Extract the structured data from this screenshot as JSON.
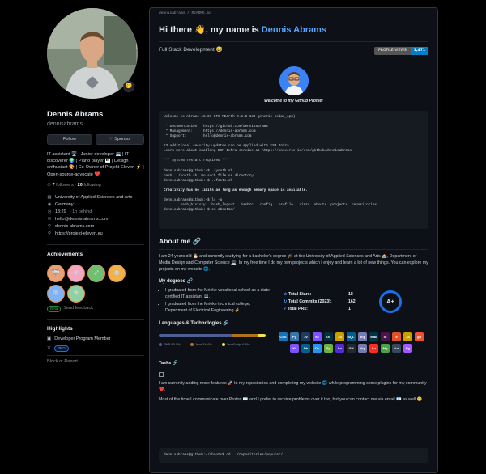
{
  "profile": {
    "name": "Dennis Abrams",
    "login": "dennisabrams",
    "follow_label": "Follow",
    "sponsor_label": "Sponsor",
    "bio": "IT assistant 🖥️ | Junior developer 💻 | IT discoverer 🌍 | Piano player 🎹 | Design enthusiast 🎨 | Co-Owner of Projekt-Eleven ⚡ | Open-source-advocate ❤️",
    "followers": "7",
    "followers_label": "followers",
    "following": "20",
    "following_label": "following",
    "details": [
      {
        "icon": "organization-icon",
        "glyph": "▦",
        "text": "University of Applied Sciences and Arts",
        "muted": ""
      },
      {
        "icon": "location-icon",
        "glyph": "◉",
        "text": "Germany",
        "muted": ""
      },
      {
        "icon": "clock-icon",
        "glyph": "◷",
        "text": "13:29",
        "muted": "- 1h behind"
      },
      {
        "icon": "mail-icon",
        "glyph": "✉",
        "text": "hello@dennis-abrams.com",
        "muted": ""
      },
      {
        "icon": "link-icon",
        "glyph": "⚲",
        "text": "dennis-abrams.com",
        "muted": ""
      },
      {
        "icon": "link-icon",
        "glyph": "⚲",
        "text": "https://projekt-eleven.eu",
        "muted": ""
      }
    ],
    "achievements_title": "Achievements",
    "beta_label": "Beta",
    "send_feedback": "Send feedback",
    "highlights_title": "Highlights",
    "highlight_item": "Developer Program Member",
    "pro_label": "PRO",
    "block_report": "Block or Report"
  },
  "readme": {
    "path": "dennisabrams / README.md",
    "greeting": "Hi there 👋, my name is ",
    "greeting_name": "Dennis Abrams",
    "subtitle": "Full Stack Development 😅",
    "views_label": "PROFILE VIEWS",
    "views_count": "1,471",
    "welcome": "Welcome to my Github Profile!",
    "terminal": [
      "Welcome to Abrams 16.01 LTS FEarth 0.6.0-149-generic solar_cpu)",
      "",
      " * Documentation:  https://github.com/dennisabrams",
      " * Management:     https://dennis-abrams.com",
      " * Support:        hello@dennis-abrams.com",
      "",
      "23 additional security updates can be applied with ESM Infra.",
      "Learn more about enabling ESM Infra service at https://universe.io/esm/github/dennisabrams",
      "",
      "*** System restart required ***",
      "",
      "dennisabrams@github:~$ ./youth.sh",
      "bash: ./youth.sh: No such file or directory",
      "dennisabrams@github:~$ ./facts.sh",
      "",
      "Creativity has no limits as long as enough memory space is available.",
      "",
      "dennisabrams@github:~$ ls -a",
      ".  ..  .bash_history  .bash_logout  .bashrc  .config  .profile  .vimrc  abouts  projects  repositories",
      "dennisabrams@github:~$ cd aboutme/"
    ],
    "about_title": "About me",
    "about_text": "I am 24 years old 🎂 and currently studying for a bachelor's degree 🎓 at the University of Applied Sciences and Arts 🏫, Department of Media Design and Computer Science 💻. In my free time I do my own projects which I enjoy and learn a lot of new things. You can explore my projects on my website 🌐.",
    "degrees_title": "My degrees",
    "degrees": [
      "I graduated from the Mrieke vocational school as a state-certified IT assistant 💻.",
      "I graduated from the Mrieke technical college, Department of Electrical Engineering ⚡."
    ],
    "stats": [
      {
        "label": "Total Stars:",
        "value": "18"
      },
      {
        "label": "Total Commits (2023):",
        "value": "162"
      },
      {
        "label": "Total PRs:",
        "value": "1"
      }
    ],
    "grade": "A+",
    "langs_title": "Languages & Technologies",
    "tasks_title": "Tasks",
    "tasks_text": "I am currently adding more features 🚀 to my repositories and completing my website 🌐 while programming some plugins for my community ❤️.",
    "contact_text": "Most of the time I communicate over Proton ✉️ and I prefer to receive problems over it too, but you can contact me via email 📧 as well 😊.",
    "bottom_cmd": "dennisabrams@github:~/abouts$ cd ../repositories/popular/"
  },
  "chart_data": {
    "type": "bar",
    "title": "",
    "categories": [
      "PHP",
      "Java",
      "JavaScript"
    ],
    "series": [
      {
        "values": [
          69,
          24.4,
          6.6
        ]
      }
    ],
    "legend": [
      "PHP 69.0%",
      "Java 24.4%",
      "JavaScript 6.6%"
    ],
    "colors": [
      "#4f5d95",
      "#b07219",
      "#f1e05a"
    ]
  },
  "tech_icons": [
    {
      "icon": "css3-icon",
      "txt": "CSS",
      "color": "#1572b6"
    },
    {
      "icon": "python-icon",
      "txt": "Py",
      "color": "#3776ab"
    },
    {
      "icon": "java-icon",
      "txt": "Jv",
      "color": "#1d3b5c"
    },
    {
      "icon": "kotlin-icon",
      "txt": "Kt",
      "color": "#7f52ff"
    },
    {
      "icon": "gradle-icon",
      "txt": "Gr",
      "color": "#02303a"
    },
    {
      "icon": "js-icon",
      "txt": "JS",
      "color": "#c9a000"
    },
    {
      "icon": "mysql-icon",
      "txt": "SQL",
      "color": "#00618a"
    },
    {
      "icon": "php-icon",
      "txt": "php",
      "color": "#777bb3"
    },
    {
      "icon": "mariadb-icon",
      "txt": "Mdb",
      "color": "#003545"
    },
    {
      "icon": "slack-icon",
      "txt": "Sl",
      "color": "#4a154b"
    },
    {
      "icon": "html5-icon",
      "txt": "5",
      "color": "#e34f26"
    },
    {
      "icon": "js-icon",
      "txt": "JS",
      "color": "#c9a000"
    },
    {
      "icon": "git-icon",
      "txt": "git",
      "color": "#f05032"
    },
    {
      "icon": "kotlin-icon",
      "txt": "Kt",
      "color": "#7f52ff"
    },
    {
      "icon": "mysql-icon",
      "txt": "Db",
      "color": "#00618a"
    },
    {
      "icon": "docker-icon",
      "txt": "Dk",
      "color": "#2496ed"
    },
    {
      "icon": "spring-icon",
      "txt": "Sp",
      "color": "#6db33f"
    },
    {
      "icon": "dotnet-icon",
      "txt": "Ln",
      "color": "#512bd4"
    },
    {
      "icon": "github-icon",
      "txt": "GH",
      "color": "#24292e"
    },
    {
      "icon": "php-icon",
      "txt": "php",
      "color": "#777bb3"
    },
    {
      "icon": "laravel-icon",
      "txt": "Lv",
      "color": "#ff2d20"
    },
    {
      "icon": "mongodb-icon",
      "txt": "Mg",
      "color": "#47a248"
    },
    {
      "icon": "vue-icon",
      "txt": "Vue",
      "color": "#35495e"
    },
    {
      "icon": "figma-icon",
      "txt": "Fg",
      "color": "#a259ff"
    }
  ],
  "achievement_badges": [
    {
      "icon": "pull-shark-icon",
      "glyph": "🦈",
      "bg": "#e8a27a"
    },
    {
      "icon": "heart-on-sleeve-icon",
      "glyph": "♥",
      "bg": "#f2a7c2"
    },
    {
      "icon": "quickdraw-icon",
      "glyph": "➶",
      "bg": "#6fbf73"
    },
    {
      "icon": "yolo-icon",
      "glyph": "☻",
      "bg": "#f1b24a"
    },
    {
      "icon": "arctic-code-vault-icon",
      "glyph": "❄",
      "bg": "#7fb3f5"
    },
    {
      "icon": "starstruck-icon",
      "glyph": "★",
      "bg": "#8fd1a0"
    }
  ]
}
